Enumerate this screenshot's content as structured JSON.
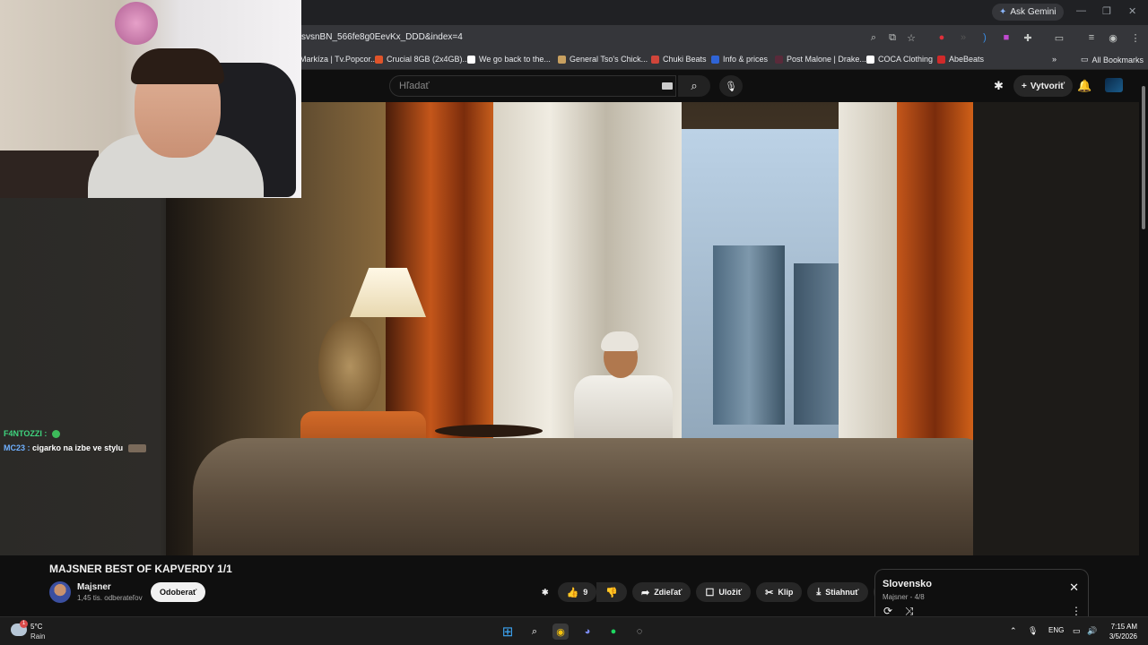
{
  "browser": {
    "url": "svsnBN_566fe8g0EevKx_DDD&index=4",
    "ask_gemini": "Ask Gemini",
    "bookmarks": [
      {
        "label": "Markíza | Tv.Popcor...",
        "color": "#2a2a2a"
      },
      {
        "label": "Crucial 8GB (2x4GB)...",
        "color": "#e0542a"
      },
      {
        "label": "We go back to the...",
        "color": "#ffffff"
      },
      {
        "label": "General Tso's Chick...",
        "color": "#c8a060"
      },
      {
        "label": "Chuki Beats",
        "color": "#d0453a"
      },
      {
        "label": "Info & prices",
        "color": "#2f64d6"
      },
      {
        "label": "Post Malone | Drake...",
        "color": "#5a2a3a"
      },
      {
        "label": "COCA Clothing",
        "color": "#ffffff"
      },
      {
        "label": "AbeBeats",
        "color": "#d02a2a"
      }
    ],
    "all_bookmarks": "All Bookmarks"
  },
  "youtube": {
    "search_placeholder": "Hľadať",
    "create_label": "Vytvoriť",
    "video_title": "MAJSNER BEST OF KAPVERDY 1/1",
    "channel_name": "Majsner",
    "channel_subs": "1,45 tis. odberateľov",
    "subscribe_label": "Odoberať",
    "like_count": "9",
    "share_label": "Zdieľať",
    "save_label": "Uložiť",
    "clip_label": "Klip",
    "download_label": "Stiahnuť",
    "more_label": "•••"
  },
  "playlist": {
    "title": "Slovensko",
    "subtitle": "Majsner - 4/8"
  },
  "chat": [
    {
      "user": "F4NTOZZI :",
      "message": ""
    },
    {
      "user": "MC23 :",
      "message": "cigarko na izbe ve stylu"
    }
  ],
  "taskbar": {
    "temp": "5°C",
    "condition": "Rain",
    "language": "ENG",
    "time": "7:15 AM",
    "date": "3/5/2026",
    "weather_badge": "1"
  }
}
